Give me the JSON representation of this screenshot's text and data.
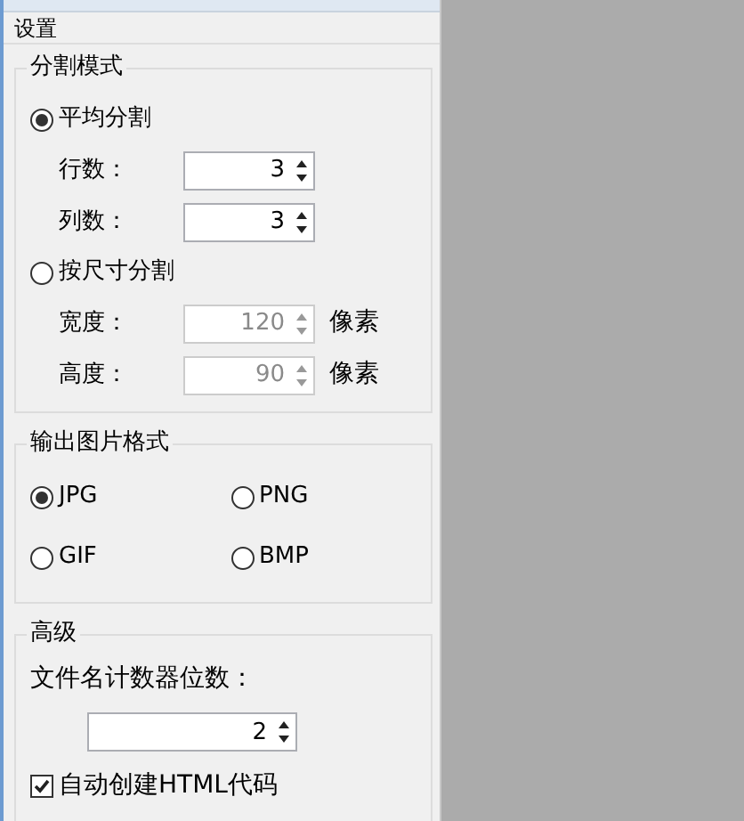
{
  "window": {
    "title": "设置"
  },
  "split_mode": {
    "title": "分割模式",
    "options": [
      {
        "label": "平均分割",
        "selected": true,
        "fields": [
          {
            "label": "行数：",
            "value": "3",
            "disabled": false
          },
          {
            "label": "列数：",
            "value": "3",
            "disabled": false
          }
        ]
      },
      {
        "label": "按尺寸分割",
        "selected": false,
        "fields": [
          {
            "label": "宽度：",
            "value": "120",
            "unit": "像素",
            "disabled": true
          },
          {
            "label": "高度：",
            "value": "90",
            "unit": "像素",
            "disabled": true
          }
        ]
      }
    ]
  },
  "output_format": {
    "title": "输出图片格式",
    "options": [
      {
        "label": "JPG",
        "selected": true
      },
      {
        "label": "PNG",
        "selected": false
      },
      {
        "label": "GIF",
        "selected": false
      },
      {
        "label": "BMP",
        "selected": false
      }
    ]
  },
  "advanced": {
    "title": "高级",
    "counter_label": "文件名计数器位数：",
    "counter": {
      "value": "2",
      "disabled": false
    },
    "auto_html": {
      "label": "自动创建HTML代码",
      "checked": true
    }
  }
}
